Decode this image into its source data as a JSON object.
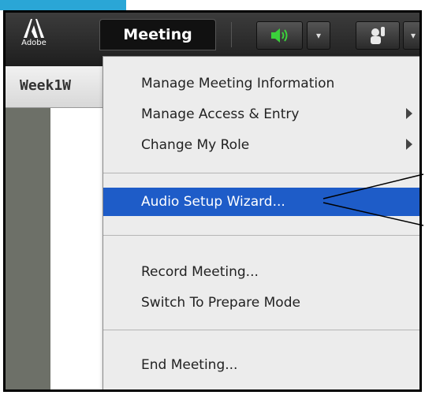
{
  "toolbar": {
    "adobe_label": "Adobe",
    "meeting_tab": "Meeting",
    "audio_icon": "speaker-icon",
    "audio_color": "#3bd13b",
    "hand_icon": "raise-hand-icon"
  },
  "pod": {
    "title": "Week1W"
  },
  "menu": {
    "items": [
      {
        "label": "Manage Meeting Information",
        "submenu": false
      },
      {
        "label": "Manage Access & Entry",
        "submenu": true
      },
      {
        "label": "Change My Role",
        "submenu": true
      },
      {
        "label": "Audio Setup Wizard...",
        "submenu": false,
        "highlighted": true
      },
      {
        "label": "Record Meeting...",
        "submenu": false
      },
      {
        "label": "Switch To Prepare Mode",
        "submenu": false
      },
      {
        "label": "End Meeting...",
        "submenu": false
      }
    ],
    "highlight_color": "#1e5cc8"
  },
  "slide": {
    "glyph_left": "\\",
    "glyph_right": "/"
  }
}
